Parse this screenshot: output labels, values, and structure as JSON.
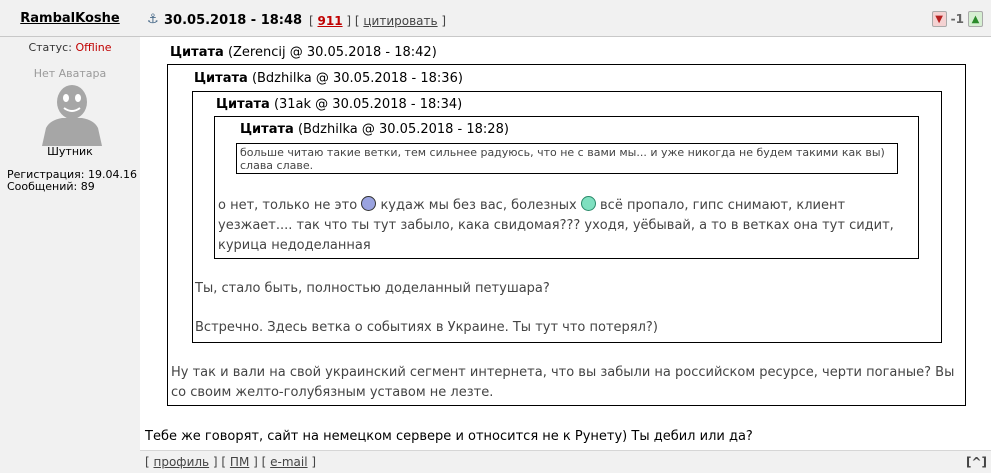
{
  "author": {
    "username": "RambalKoshe",
    "status_label": "Статус:",
    "status_value": "Offline",
    "avatar_placeholder": "Нет Аватара",
    "rank": "Шутник",
    "registration": "Регистрация: 19.04.16",
    "posts": "Сообщений: 89"
  },
  "post_header": {
    "datetime": "30.05.2018 - 18:48",
    "post_number": "911",
    "quote_link": "цитировать",
    "rating": "-1"
  },
  "quotes": {
    "q1": {
      "label": "Цитата",
      "meta": "(Zerencij @ 30.05.2018 - 18:42)",
      "text": "Ну так и вали на свой украинский сегмент интернета, что вы забыли на российском ресурсе, черти поганые? Вы со своим желто-голубязным уставом не лезте."
    },
    "q2": {
      "label": "Цитата",
      "meta": "(Bdzhilka @ 30.05.2018 - 18:36)",
      "text1": "Ты, стало быть, полностью доделанный петушара?",
      "text2": "Встречно. Здесь ветка о событиях в Украине. Ты тут что потерял?)"
    },
    "q3": {
      "label": "Цитата",
      "meta": "(31ak @ 30.05.2018 - 18:34)",
      "text_a": "о нет, только не это",
      "text_b": "кудаж мы без вас, болезных",
      "text_c": "всё пропало, гипс снимают, клиент уезжает.... так что ты тут забыло, кака свидомая??? уходя, уёбывай, а то в ветках она тут сидит, курица недоделанная"
    },
    "q4": {
      "label": "Цитата",
      "meta": "(Bdzhilka @ 30.05.2018 - 18:28)",
      "text": "больше читаю такие ветки, тем сильнее радуюсь, что не с вами мы... и уже никогда не будем такими как вы) слава славе."
    }
  },
  "reply": "Тебе же говорят, сайт на немецком сервере и относится не к Рунету) Ты дебил или да?",
  "footer": {
    "profile": "профиль",
    "pm": "ПМ",
    "email": "e-mail",
    "top": "[^]"
  }
}
